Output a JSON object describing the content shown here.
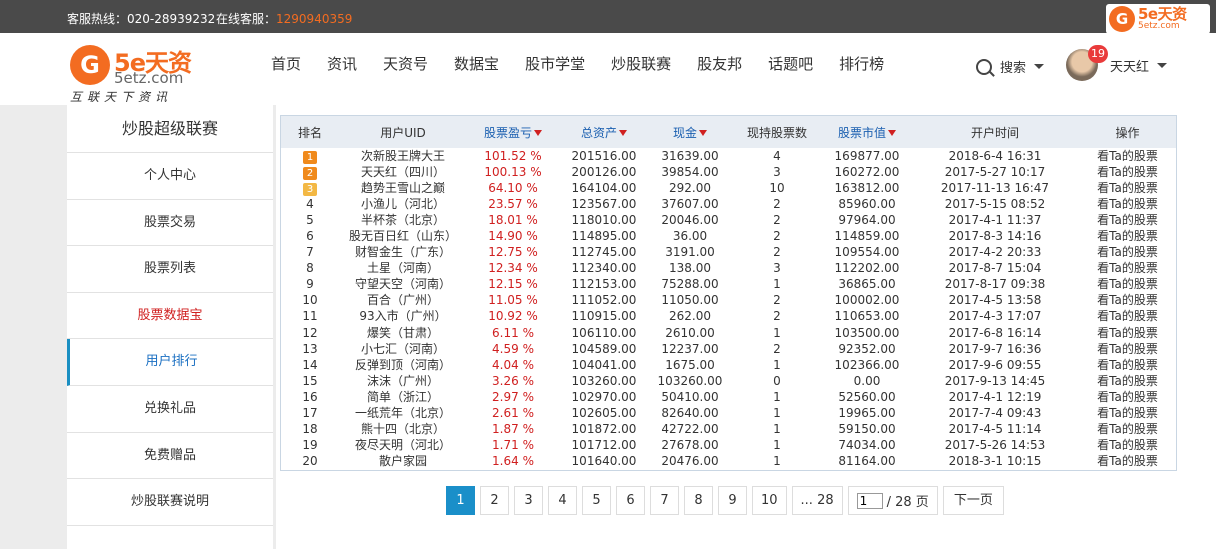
{
  "topbar": {
    "hotline": "客服热线：020-28939232",
    "online_label": "在线客服：",
    "online_qq": "1290940359",
    "logo_brand": "5e天资",
    "logo_site": "5etz.com"
  },
  "header": {
    "logo_brand": "5e天资",
    "logo_site": "5etz.com",
    "slogan": "互联天下资讯",
    "nav": [
      "首页",
      "资讯",
      "天资号",
      "数据宝",
      "股市学堂",
      "炒股联赛",
      "股友邦",
      "话题吧",
      "排行榜"
    ],
    "search_label": "搜索",
    "user_badge": "19",
    "user_name": "天天红"
  },
  "sidebar": {
    "title": "炒股超级联赛",
    "items": [
      "个人中心",
      "股票交易",
      "股票列表",
      "股票数据宝",
      "用户排行",
      "兑换礼品",
      "免费赠品",
      "炒股联赛说明"
    ]
  },
  "table": {
    "headers": [
      "排名",
      "用户UID",
      "股票盈亏",
      "总资产",
      "现金",
      "现持股票数",
      "股票市值",
      "开户时间",
      "操作"
    ],
    "rows": [
      [
        "1",
        "次新股王牌大王",
        "101.52 %",
        "201516.00",
        "31639.00",
        "4",
        "169877.00",
        "2018-6-4 16:31",
        "看Ta的股票"
      ],
      [
        "2",
        "天天红（四川）",
        "100.13 %",
        "200126.00",
        "39854.00",
        "3",
        "160272.00",
        "2017-5-27 10:17",
        "看Ta的股票"
      ],
      [
        "3",
        "趋势王雪山之巅",
        "64.10 %",
        "164104.00",
        "292.00",
        "10",
        "163812.00",
        "2017-11-13 16:47",
        "看Ta的股票"
      ],
      [
        "4",
        "小渔儿（河北）",
        "23.57 %",
        "123567.00",
        "37607.00",
        "2",
        "85960.00",
        "2017-5-15 08:52",
        "看Ta的股票"
      ],
      [
        "5",
        "半杯茶（北京）",
        "18.01 %",
        "118010.00",
        "20046.00",
        "2",
        "97964.00",
        "2017-4-1 11:37",
        "看Ta的股票"
      ],
      [
        "6",
        "股无百日红（山东）",
        "14.90 %",
        "114895.00",
        "36.00",
        "2",
        "114859.00",
        "2017-8-3 14:16",
        "看Ta的股票"
      ],
      [
        "7",
        "财智金生（广东）",
        "12.75 %",
        "112745.00",
        "3191.00",
        "2",
        "109554.00",
        "2017-4-2 20:33",
        "看Ta的股票"
      ],
      [
        "8",
        "土星（河南）",
        "12.34 %",
        "112340.00",
        "138.00",
        "3",
        "112202.00",
        "2017-8-7 15:04",
        "看Ta的股票"
      ],
      [
        "9",
        "守望天空（河南）",
        "12.15 %",
        "112153.00",
        "75288.00",
        "1",
        "36865.00",
        "2017-8-17 09:38",
        "看Ta的股票"
      ],
      [
        "10",
        "百合（广州）",
        "11.05 %",
        "111052.00",
        "11050.00",
        "2",
        "100002.00",
        "2017-4-5 13:58",
        "看Ta的股票"
      ],
      [
        "11",
        "93入市（广州）",
        "10.92 %",
        "110915.00",
        "262.00",
        "2",
        "110653.00",
        "2017-4-3 17:07",
        "看Ta的股票"
      ],
      [
        "12",
        "爆笑（甘肃）",
        "6.11 %",
        "106110.00",
        "2610.00",
        "1",
        "103500.00",
        "2017-6-8 16:14",
        "看Ta的股票"
      ],
      [
        "13",
        "小七汇（河南）",
        "4.59 %",
        "104589.00",
        "12237.00",
        "2",
        "92352.00",
        "2017-9-7 16:36",
        "看Ta的股票"
      ],
      [
        "14",
        "反弹到顶（河南）",
        "4.04 %",
        "104041.00",
        "1675.00",
        "1",
        "102366.00",
        "2017-9-6 09:55",
        "看Ta的股票"
      ],
      [
        "15",
        "沫沫（广州）",
        "3.26 %",
        "103260.00",
        "103260.00",
        "0",
        "0.00",
        "2017-9-13 14:45",
        "看Ta的股票"
      ],
      [
        "16",
        "简单（浙江）",
        "2.97 %",
        "102970.00",
        "50410.00",
        "1",
        "52560.00",
        "2017-4-1 12:19",
        "看Ta的股票"
      ],
      [
        "17",
        "一纸荒年（北京）",
        "2.61 %",
        "102605.00",
        "82640.00",
        "1",
        "19965.00",
        "2017-7-4 09:43",
        "看Ta的股票"
      ],
      [
        "18",
        "熊十四（北京）",
        "1.87 %",
        "101872.00",
        "42722.00",
        "1",
        "59150.00",
        "2017-4-5 11:14",
        "看Ta的股票"
      ],
      [
        "19",
        "夜尽天明（河北）",
        "1.71 %",
        "101712.00",
        "27678.00",
        "1",
        "74034.00",
        "2017-5-26 14:53",
        "看Ta的股票"
      ],
      [
        "20",
        "散户家园",
        "1.64 %",
        "101640.00",
        "20476.00",
        "1",
        "81164.00",
        "2018-3-1 10:15",
        "看Ta的股票"
      ]
    ]
  },
  "pager": {
    "pages": [
      "1",
      "2",
      "3",
      "4",
      "5",
      "6",
      "7",
      "8",
      "9",
      "10",
      "... 28"
    ],
    "current": "1",
    "jump_value": "1",
    "total": "/ 28 页",
    "next": "下一页"
  },
  "colors": {
    "accent_orange": "#f36c21",
    "active_blue": "#1a8fc9",
    "pct_red": "#d02020"
  }
}
